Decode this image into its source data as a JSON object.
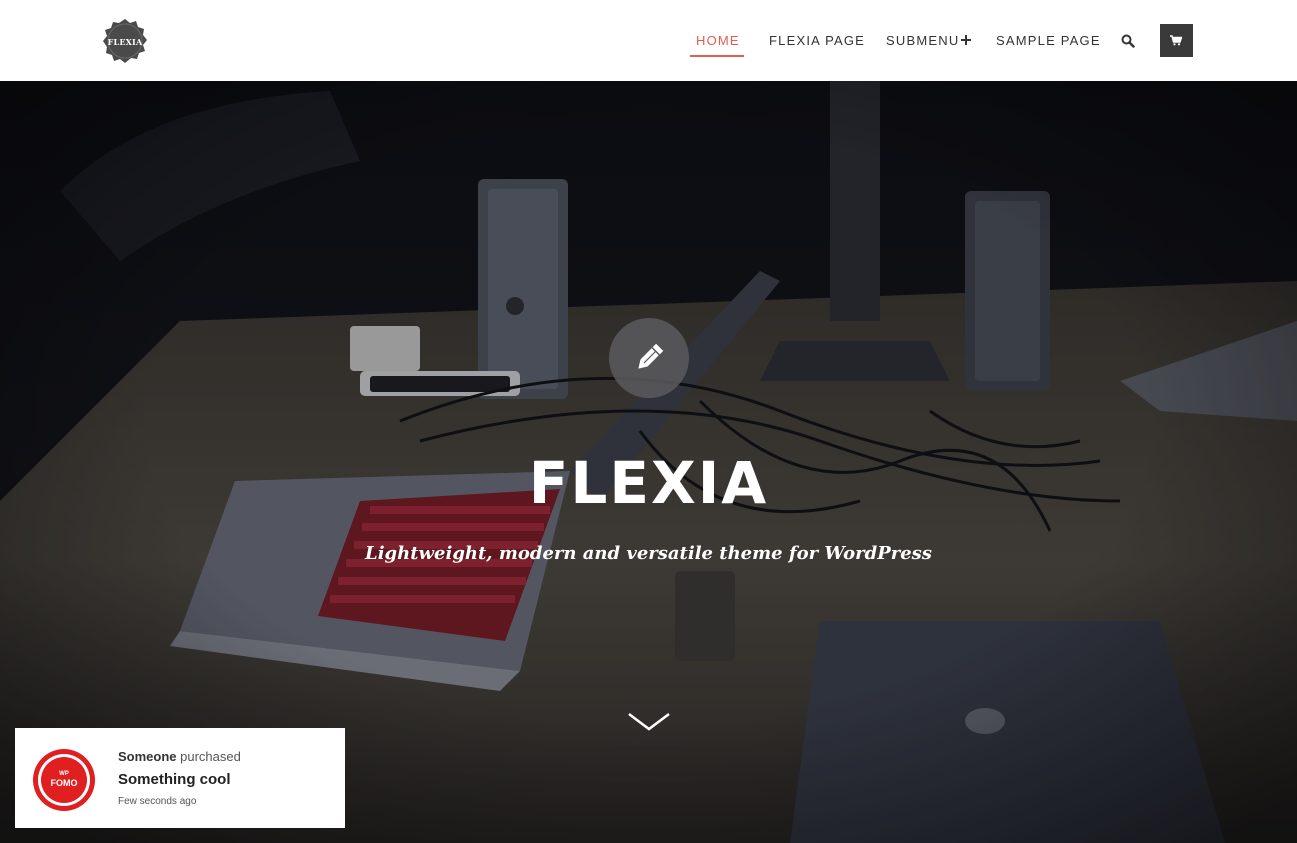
{
  "site": {
    "logo_text": "FLEXIA"
  },
  "nav": {
    "items": [
      {
        "label": "HOME",
        "active": true
      },
      {
        "label": "FLEXIA PAGE",
        "active": false
      },
      {
        "label": "SUBMENU",
        "active": false,
        "has_submenu": true
      },
      {
        "label": "SAMPLE PAGE",
        "active": false
      }
    ],
    "search_icon": "search-icon",
    "cart_icon": "cart-icon"
  },
  "hero": {
    "icon": "pencil-icon",
    "title": "FLEXIA",
    "tagline": "Lightweight, modern and versatile theme for WordPress",
    "scroll_icon": "chevron-down-icon"
  },
  "notification": {
    "logo_small": "WP",
    "logo_text": "FOMO",
    "buyer": "Someone",
    "action": "purchased",
    "product": "Something cool",
    "time": "Few seconds ago"
  },
  "colors": {
    "accent": "#e45c4f",
    "nav_text": "#333333",
    "cart_bg": "#3a3a3a",
    "fomo_red": "#e02020"
  }
}
